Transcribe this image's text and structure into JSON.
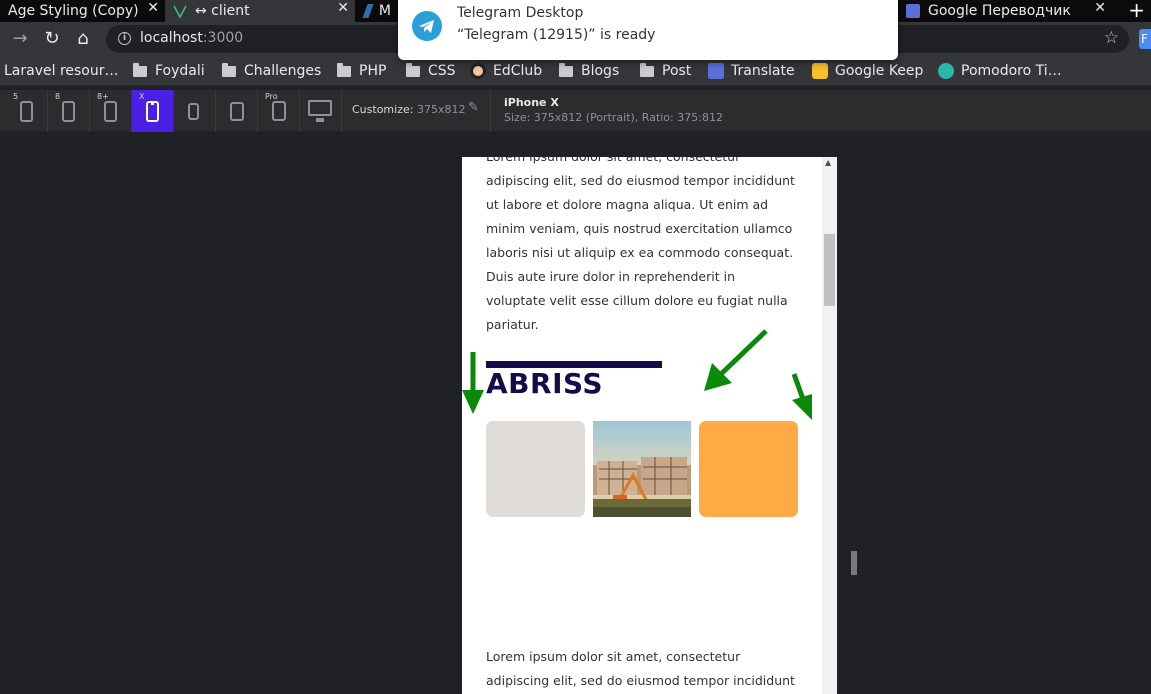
{
  "tabs": [
    {
      "title": "Age Styling (Copy)",
      "active": false
    },
    {
      "title": "↔ client",
      "active": true
    },
    {
      "title": "M",
      "active": false
    },
    {
      "title": "Google Переводчик",
      "active": false
    }
  ],
  "nav": {
    "url_host": "localhost",
    "url_port": ":3000"
  },
  "bookmarks": [
    {
      "label": "Laravel resour…",
      "icon": "none"
    },
    {
      "label": "Foydali",
      "icon": "folder-icon"
    },
    {
      "label": "Challenges",
      "icon": "folder-icon"
    },
    {
      "label": "PHP",
      "icon": "folder-icon"
    },
    {
      "label": "CSS",
      "icon": "folder-icon"
    },
    {
      "label": "EdClub",
      "icon": "edclub-icon"
    },
    {
      "label": "Blogs",
      "icon": "folder-icon"
    },
    {
      "label": "Post",
      "icon": "folder-icon"
    },
    {
      "label": "Translate",
      "icon": "translate-icon"
    },
    {
      "label": "Google Keep",
      "icon": "keep-icon"
    },
    {
      "label": "Pomodoro Ti…",
      "icon": "pomodoro-icon"
    }
  ],
  "devices": [
    {
      "label": "5"
    },
    {
      "label": "8"
    },
    {
      "label": "8+"
    },
    {
      "label": "X",
      "active": true
    },
    {
      "label": ""
    },
    {
      "label": ""
    },
    {
      "label": "Pro"
    },
    {
      "label": ""
    }
  ],
  "devtools": {
    "customize_label": "Customize:",
    "customize_size": "375x812",
    "device_name": "iPhone X",
    "device_info": "Size: 375x812 (Portrait), Ratio: 375:812"
  },
  "notification": {
    "app": "Telegram Desktop",
    "message": "“Telegram (12915)” is ready"
  },
  "page": {
    "paragraph1": "Lorem ipsum dolor sit amet, consectetur adipiscing elit, sed do eiusmod tempor incididunt ut labore et dolore magna aliqua. Ut enim ad minim veniam, quis nostrud exercitation ullamco laboris nisi ut aliquip ex ea commodo consequat. Duis aute irure dolor in reprehenderit in voluptate velit esse cillum dolore eu fugiat nulla pariatur.",
    "heading": "ABRISS",
    "paragraph2": "Lorem ipsum dolor sit amet, consectetur adipiscing elit, sed do eiusmod tempor incididunt ut labore et"
  },
  "colors": {
    "heading": "#120c4d",
    "card_gray": "#e0dcda",
    "card_orange": "#ffaa44",
    "device_active": "#4a1fe6",
    "annotation_arrow": "#0a8a0a"
  }
}
